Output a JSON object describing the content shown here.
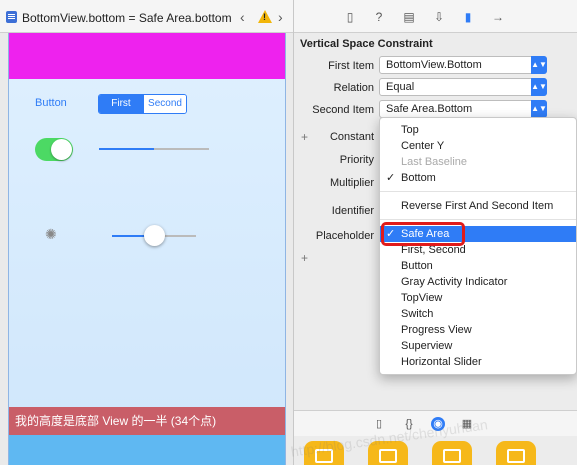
{
  "jump_bar": {
    "title": "BottomView.bottom = Safe Area.bottom",
    "prev_icon": "‹",
    "next_icon": "›",
    "warning_icon": "!"
  },
  "canvas": {
    "button_label": "Button",
    "segment_first": "First",
    "segment_second": "Second",
    "switch_on": true,
    "progress_value": 0.5,
    "slider_value": 0.5,
    "spinner_glyph": "✺",
    "bottom_view_text": "我的高度是底部 View 的一半 (34个点)",
    "colors": {
      "top_view": "#ee22ee",
      "bottom_view": "#c95e68",
      "safe_area_bottom": "#5fb8f2"
    }
  },
  "inspector": {
    "section_title": "Vertical Space Constraint",
    "first_item_label": "First Item",
    "first_item_value": "BottomView.Bottom",
    "relation_label": "Relation",
    "relation_value": "Equal",
    "second_item_label": "Second Item",
    "second_item_value": "Safe Area.Bottom",
    "constant_label": "Constant",
    "priority_label": "Priority",
    "multiplier_label": "Multiplier",
    "identifier_label": "Identifier",
    "placeholder_label": "Placeholder",
    "plus": "+"
  },
  "inspector_tabs": [
    "file-icon",
    "help-icon",
    "identity-icon",
    "attributes-icon",
    "size-icon",
    "connections-icon"
  ],
  "library_tabs": [
    "file-template-icon",
    "code-snippet-icon",
    "object-library-icon",
    "media-library-icon"
  ],
  "menu": {
    "group1": [
      {
        "label": "Top"
      },
      {
        "label": "Center Y"
      },
      {
        "label": "Last Baseline",
        "disabled": true
      },
      {
        "label": "Bottom",
        "checked": true
      }
    ],
    "reverse_label": "Reverse First And Second Item",
    "group2": [
      {
        "label": "Safe Area",
        "checked": true,
        "selected": true
      },
      {
        "label": "First, Second"
      },
      {
        "label": "Button"
      },
      {
        "label": "Gray Activity Indicator"
      },
      {
        "label": "TopView"
      },
      {
        "label": "Switch"
      },
      {
        "label": "Progress View"
      },
      {
        "label": "Superview"
      },
      {
        "label": "Horizontal Slider"
      }
    ],
    "check_glyph": "✓",
    "highlight_color": "#e01b1b"
  },
  "watermark": "http://blog.csdn.net/chenyuhuan"
}
